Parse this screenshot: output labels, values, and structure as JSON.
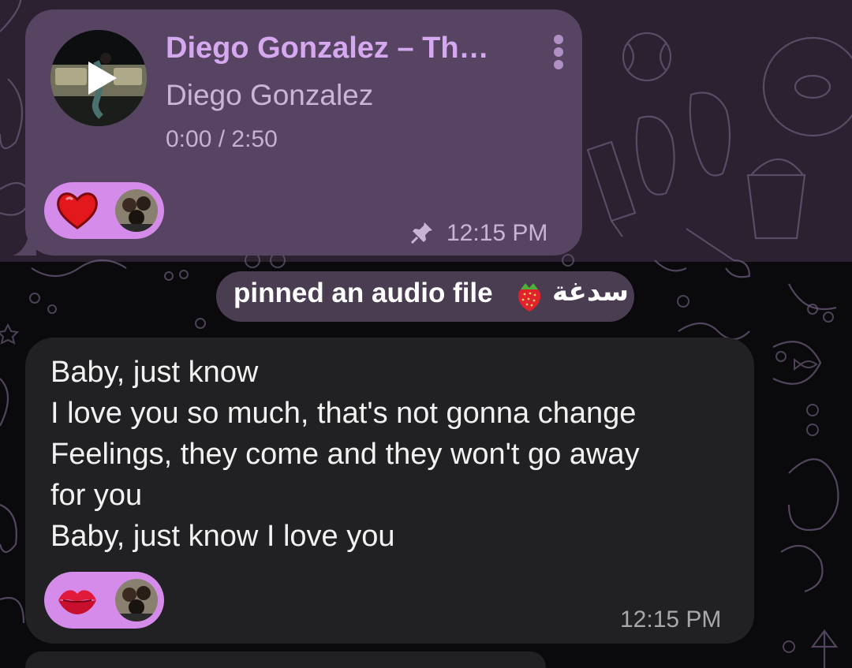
{
  "audio_message": {
    "title": "Diego Gonzalez – Th…",
    "artist": "Diego Gonzalez",
    "time": "0:00 / 2:50",
    "reaction_emoji": "red-heart",
    "timestamp": "12:15 PM",
    "pinned": true
  },
  "service_message": {
    "text": "pinned an audio file",
    "emoji": "strawberry",
    "name": "سدغة"
  },
  "text_message": {
    "lines": [
      "Baby, just know",
      "I love you so much, that's not gonna change",
      "Feelings, they come and they won't go away",
      "for you",
      "Baby, just know I love you"
    ],
    "reaction_emoji": "kiss-mark",
    "timestamp": "12:15 PM"
  },
  "colors": {
    "outgoing_bubble": "#574462",
    "incoming_bubble": "#212022",
    "reaction_pill": "#d48be9",
    "accent_title": "#d6a8ef"
  }
}
